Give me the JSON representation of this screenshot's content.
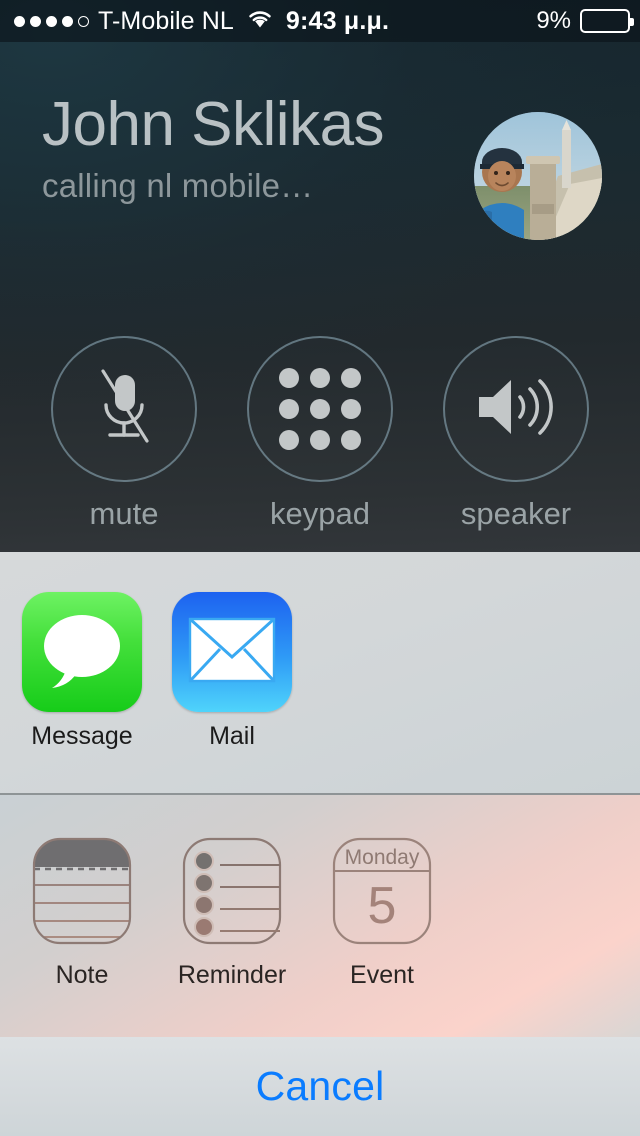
{
  "status_bar": {
    "signal_total": 5,
    "signal_filled": 4,
    "carrier": "T-Mobile NL",
    "wifi_icon": "wifi-icon",
    "time": "9:43 μ.μ.",
    "battery_percent_label": "9%",
    "battery_level": 9,
    "battery_color": "#f5362c",
    "text_color": "#ffffff"
  },
  "call": {
    "caller_name": "John Sklikas",
    "call_status": "calling nl mobile…",
    "avatar_alt": "contact-photo",
    "buttons": [
      {
        "label": "mute",
        "icon": "microphone-slash-icon",
        "active": false
      },
      {
        "label": "keypad",
        "icon": "keypad-grid-icon",
        "active": false
      },
      {
        "label": "speaker",
        "icon": "speaker-waves-icon",
        "active": false
      }
    ],
    "background_color": "#1b2a31",
    "label_color": "#9aa3a6"
  },
  "share_sheet": {
    "apps": [
      {
        "label": "Message",
        "icon": "message-bubble-icon",
        "color": "#3ddc3d"
      },
      {
        "label": "Mail",
        "icon": "mail-envelope-icon",
        "color": "#2f9bf6"
      }
    ],
    "actions": [
      {
        "label": "Note",
        "icon": "note-lines-icon"
      },
      {
        "label": "Reminder",
        "icon": "reminder-list-icon"
      },
      {
        "label": "Event",
        "icon": "calendar-event-icon",
        "day_name": "Monday",
        "day_number": "5"
      }
    ],
    "cancel_label": "Cancel",
    "cancel_color": "#0a7cff"
  }
}
